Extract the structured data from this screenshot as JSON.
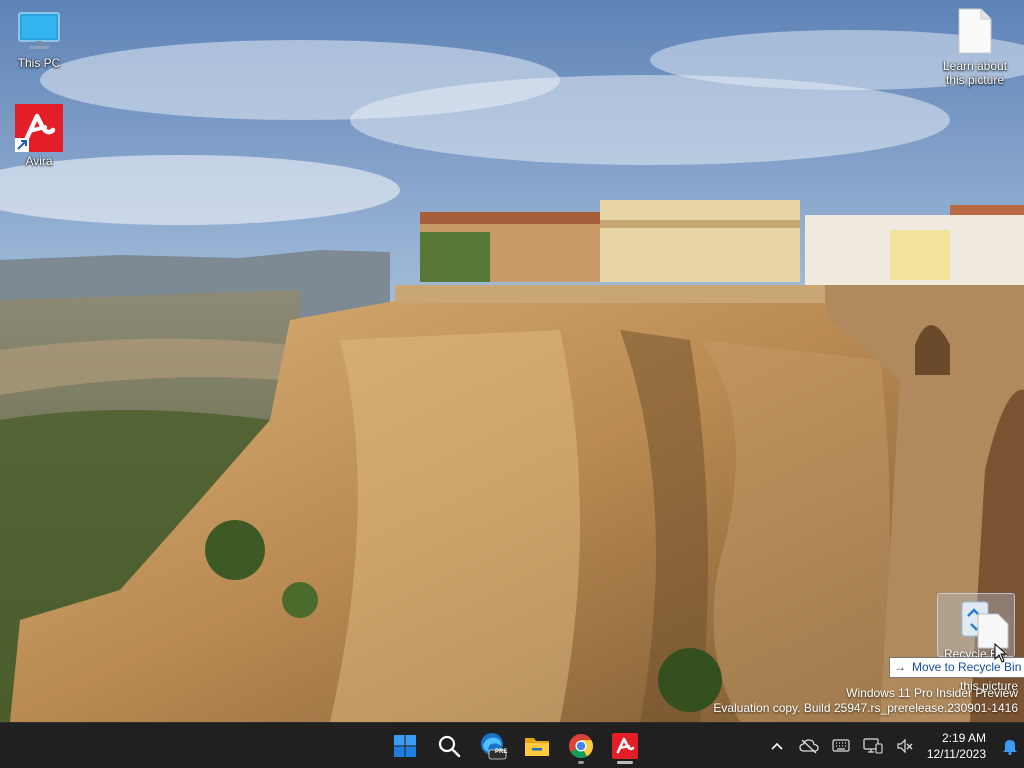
{
  "desktop": {
    "icons": [
      {
        "label": "This PC",
        "icon": "monitor-icon"
      },
      {
        "label": "Avira",
        "icon": "avira-icon"
      },
      {
        "label": "Learn about this picture",
        "icon": "document-icon"
      }
    ]
  },
  "drag": {
    "ghost_label_1": "Recycle Bin",
    "ghost_label_2": "this picture",
    "tooltip_label": "Move to Recycle Bin",
    "tooltip_icon": "arrow-right-icon"
  },
  "watermark": {
    "line1": "Windows 11 Pro Insider Preview",
    "line2": "Evaluation copy. Build 25947.rs_prerelease.230901-1416"
  },
  "taskbar": {
    "apps": [
      {
        "name": "Start",
        "icon": "windows-start-icon"
      },
      {
        "name": "Search",
        "icon": "search-icon"
      },
      {
        "name": "Microsoft Edge Insider",
        "icon": "edge-pre-icon",
        "badge": "PRE"
      },
      {
        "name": "File Explorer",
        "icon": "folder-icon"
      },
      {
        "name": "Google Chrome",
        "icon": "chrome-icon"
      },
      {
        "name": "Avira",
        "icon": "avira-icon"
      }
    ],
    "tray": [
      "chevron-up-icon",
      "cloud-offline-icon",
      "keyboard-icon",
      "network-icon",
      "volume-muted-icon"
    ],
    "time": "2:19 AM",
    "date": "12/11/2023",
    "notification_icon": "bell-icon"
  },
  "colors": {
    "taskbar_bg": "#202020",
    "avira_red": "#e41e26",
    "windows_blue": "#0078d4",
    "tooltip_text": "#1a4aa3"
  }
}
